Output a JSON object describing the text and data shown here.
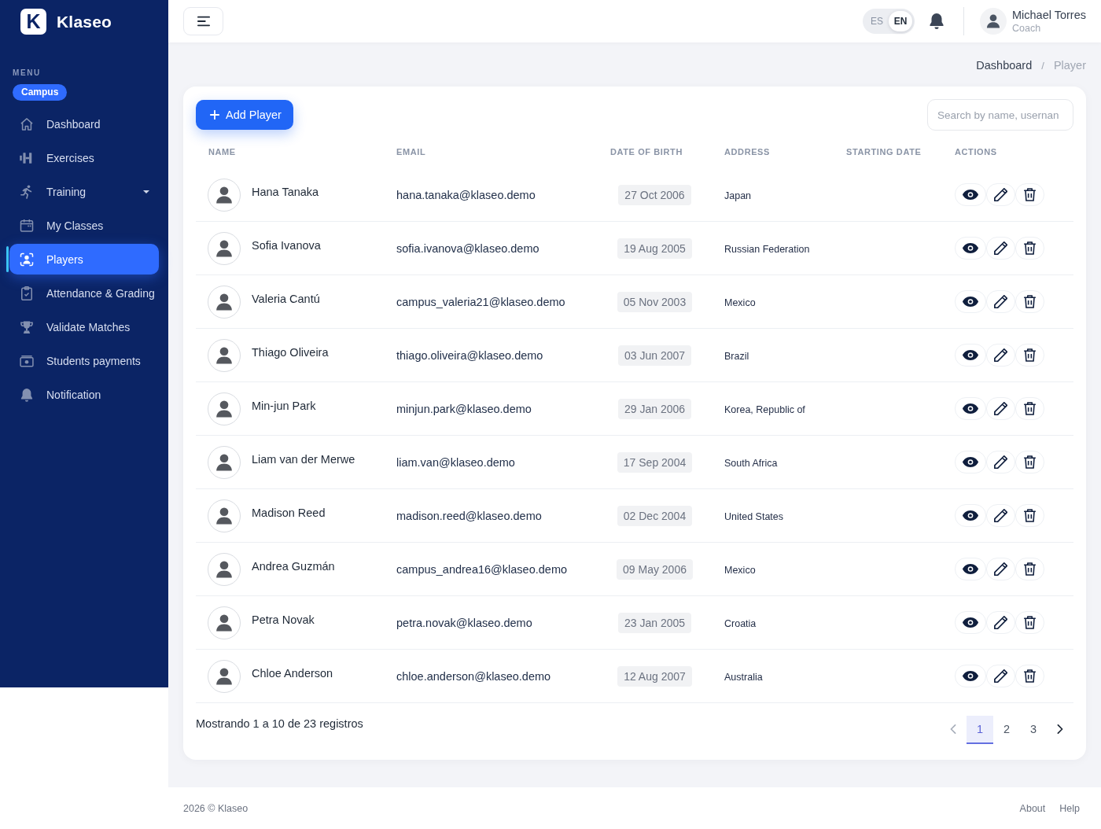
{
  "sidebar": {
    "logo": {
      "mark": "K",
      "wordmark": "Klaseo"
    },
    "menu_label": "MENU",
    "section_tag": "Campus",
    "items": [
      {
        "label": "Dashboard",
        "kind": "link",
        "selected": false
      },
      {
        "label": "Exercises",
        "kind": "link",
        "selected": false
      },
      {
        "label": "Training",
        "kind": "dropdown",
        "selected": false
      },
      {
        "label": "My Classes",
        "kind": "link",
        "selected": false
      },
      {
        "label": "Players",
        "kind": "link",
        "selected": true
      },
      {
        "label": "Attendance & Grading",
        "kind": "link",
        "selected": false
      },
      {
        "label": "Validate Matches",
        "kind": "link",
        "selected": false
      },
      {
        "label": "Students payments",
        "kind": "link",
        "selected": false
      },
      {
        "label": "Notification",
        "kind": "link",
        "selected": false
      }
    ]
  },
  "topbar": {
    "languages": [
      {
        "label": "ES",
        "selected": false
      },
      {
        "label": "EN",
        "selected": true
      }
    ],
    "user": {
      "name": "Michael Torres",
      "role": "Coach"
    }
  },
  "breadcrumb": {
    "separator": "/",
    "items": [
      {
        "label": "Dashboard",
        "current": false
      },
      {
        "label": "Player",
        "current": true
      }
    ]
  },
  "players": {
    "add_button": "Add Player",
    "search": {
      "placeholder": "Search by name, usernan"
    },
    "columns": [
      "NAME",
      "EMAIL",
      "DATE OF BIRTH",
      "ADDRESS",
      "STARTING DATE",
      "ACTIONS"
    ],
    "rows": [
      {
        "name": "Hana Tanaka",
        "email": "hana.tanaka@klaseo.demo",
        "date_of_birth": "27 Oct 2006",
        "address": "Japan"
      },
      {
        "name": "Sofia Ivanova",
        "email": "sofia.ivanova@klaseo.demo",
        "date_of_birth": "19 Aug 2005",
        "address": "Russian Federation"
      },
      {
        "name": "Valeria Cantú",
        "email": "campus_valeria21@klaseo.demo",
        "date_of_birth": "05 Nov 2003",
        "address": "Mexico"
      },
      {
        "name": "Thiago Oliveira",
        "email": "thiago.oliveira@klaseo.demo",
        "date_of_birth": "03 Jun 2007",
        "address": "Brazil"
      },
      {
        "name": "Min-jun Park",
        "email": "minjun.park@klaseo.demo",
        "date_of_birth": "29 Jan 2006",
        "address": "Korea, Republic of"
      },
      {
        "name": "Liam van der Merwe",
        "email": "liam.van@klaseo.demo",
        "date_of_birth": "17 Sep 2004",
        "address": "South Africa"
      },
      {
        "name": "Madison Reed",
        "email": "madison.reed@klaseo.demo",
        "date_of_birth": "02 Dec 2004",
        "address": "United States"
      },
      {
        "name": "Andrea Guzmán",
        "email": "campus_andrea16@klaseo.demo",
        "date_of_birth": "09 May 2006",
        "address": "Mexico"
      },
      {
        "name": "Petra Novak",
        "email": "petra.novak@klaseo.demo",
        "date_of_birth": "23 Jan 2005",
        "address": "Croatia"
      },
      {
        "name": "Chloe Anderson",
        "email": "chloe.anderson@klaseo.demo",
        "date_of_birth": "12 Aug 2007",
        "address": "Australia"
      }
    ],
    "summary": "Mostrando 1 a 10 de 23 registros",
    "pagination": {
      "previous": {
        "disabled": true
      },
      "next": {
        "disabled": false
      },
      "pages": [
        {
          "label": "1",
          "selected": true
        },
        {
          "label": "2",
          "selected": false
        },
        {
          "label": "3",
          "selected": false
        }
      ]
    }
  },
  "footer": {
    "copyright": "2026 © Klaseo",
    "links": [
      "About",
      "Help"
    ]
  }
}
